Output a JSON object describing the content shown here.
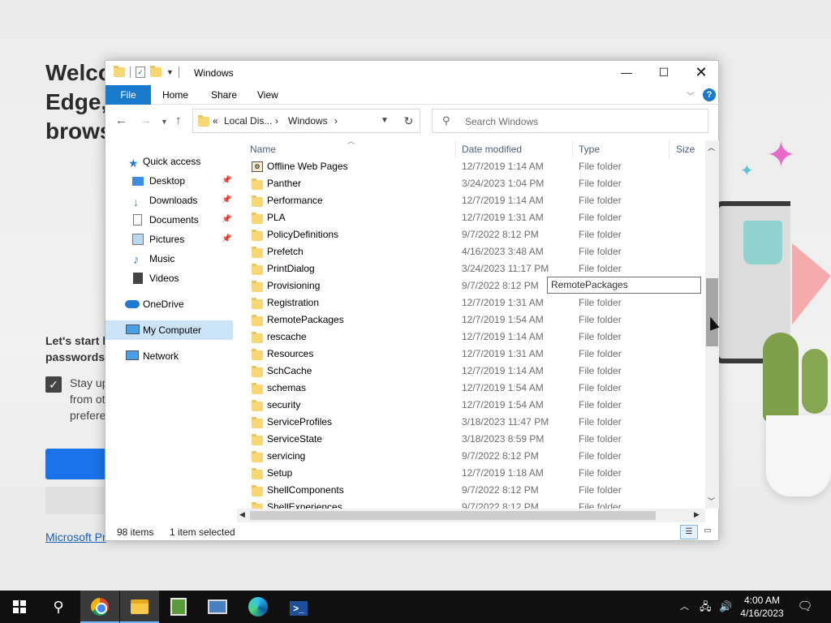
{
  "background": {
    "welcome_lines": [
      "Welco",
      "Edge,",
      "brows"
    ],
    "start_lines": [
      "Let's start b",
      "passwords,"
    ],
    "stay_lines": [
      "Stay up",
      "from ot",
      "prefere"
    ],
    "privacy_link": "Microsoft Pr"
  },
  "window": {
    "title": "Windows",
    "ribbon": {
      "file": "File",
      "home": "Home",
      "share": "Share",
      "view": "View",
      "help": "?"
    },
    "nav": {
      "breadcrumb_prefix": "«",
      "crumb_local": "Local Dis...",
      "crumb_windows": "Windows",
      "search_placeholder": "Search Windows"
    },
    "sidebar": {
      "quick_access": "Quick access",
      "desktop": "Desktop",
      "downloads": "Downloads",
      "documents": "Documents",
      "pictures": "Pictures",
      "music": "Music",
      "videos": "Videos",
      "onedrive": "OneDrive",
      "my_computer": "My Computer",
      "network": "Network"
    },
    "columns": {
      "name": "Name",
      "date": "Date modified",
      "type": "Type",
      "size": "Size"
    },
    "files": [
      {
        "name": "Offline Web Pages",
        "date": "12/7/2019 1:14 AM",
        "type": "File folder"
      },
      {
        "name": "Panther",
        "date": "3/24/2023 1:04 PM",
        "type": "File folder"
      },
      {
        "name": "Performance",
        "date": "12/7/2019 1:14 AM",
        "type": "File folder"
      },
      {
        "name": "PLA",
        "date": "12/7/2019 1:31 AM",
        "type": "File folder"
      },
      {
        "name": "PolicyDefinitions",
        "date": "9/7/2022 8:12 PM",
        "type": "File folder"
      },
      {
        "name": "Prefetch",
        "date": "4/16/2023 3:48 AM",
        "type": "File folder"
      },
      {
        "name": "PrintDialog",
        "date": "3/24/2023 11:17 PM",
        "type": "File folder"
      },
      {
        "name": "Provisioning",
        "date": "9/7/2022 8:12 PM",
        "type": ""
      },
      {
        "name": "Registration",
        "date": "12/7/2019 1:31 AM",
        "type": "File folder"
      },
      {
        "name": "RemotePackages",
        "date": "12/7/2019 1:54 AM",
        "type": "File folder"
      },
      {
        "name": "rescache",
        "date": "12/7/2019 1:14 AM",
        "type": "File folder"
      },
      {
        "name": "Resources",
        "date": "12/7/2019 1:31 AM",
        "type": "File folder"
      },
      {
        "name": "SchCache",
        "date": "12/7/2019 1:14 AM",
        "type": "File folder"
      },
      {
        "name": "schemas",
        "date": "12/7/2019 1:54 AM",
        "type": "File folder"
      },
      {
        "name": "security",
        "date": "12/7/2019 1:54 AM",
        "type": "File folder"
      },
      {
        "name": "ServiceProfiles",
        "date": "3/18/2023 11:47 PM",
        "type": "File folder"
      },
      {
        "name": "ServiceState",
        "date": "3/18/2023 8:59 PM",
        "type": "File folder"
      },
      {
        "name": "servicing",
        "date": "9/7/2022 8:12 PM",
        "type": "File folder"
      },
      {
        "name": "Setup",
        "date": "12/7/2019 1:18 AM",
        "type": "File folder"
      },
      {
        "name": "ShellComponents",
        "date": "9/7/2022 8:12 PM",
        "type": "File folder"
      },
      {
        "name": "ShellExperiences",
        "date": "9/7/2022 8:12 PM",
        "type": "File folder"
      }
    ],
    "tooltip": "RemotePackages",
    "status": {
      "count": "98 items",
      "selected": "1 item selected"
    }
  },
  "taskbar": {
    "time": "4:00 AM",
    "date": "4/16/2023"
  }
}
